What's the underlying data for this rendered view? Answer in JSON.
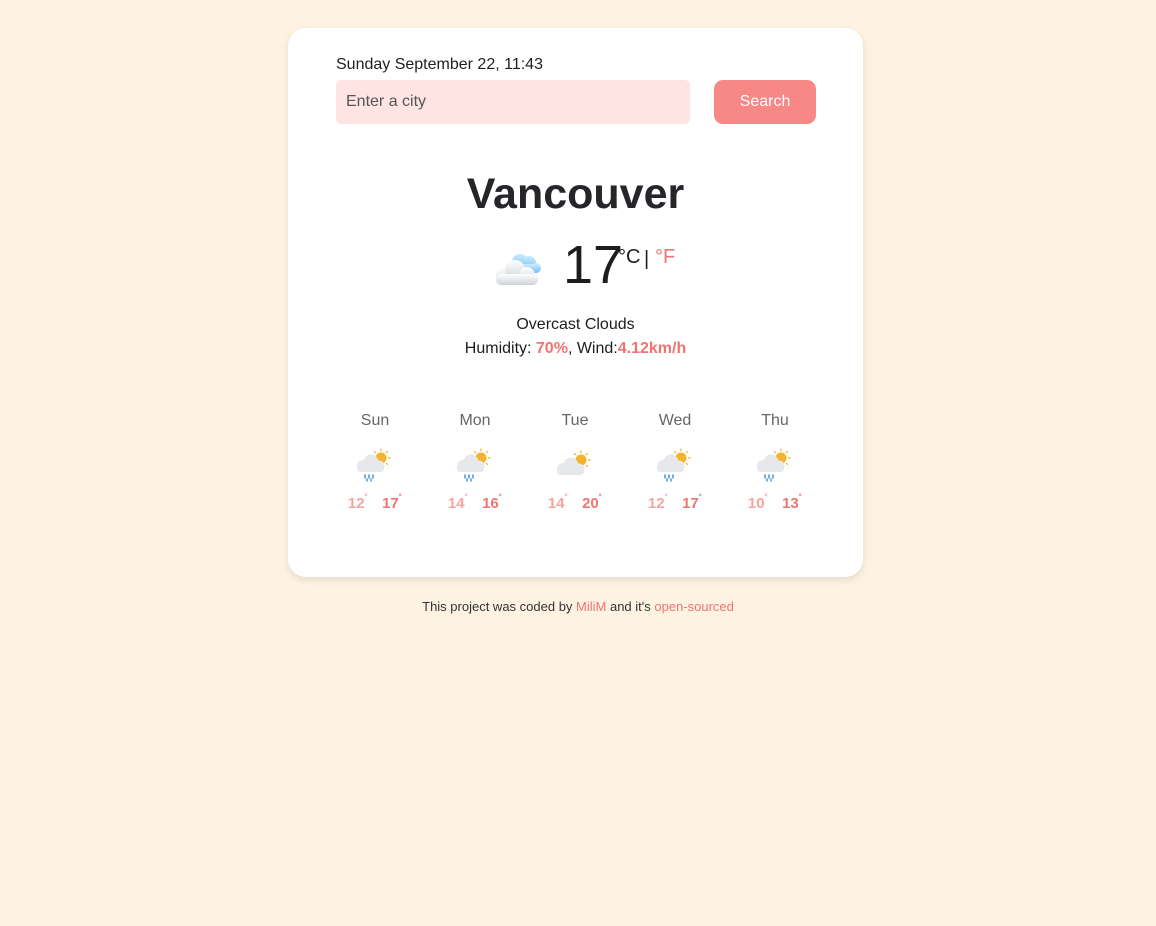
{
  "header": {
    "datetime": "Sunday September 22, 11:43"
  },
  "search": {
    "placeholder": "Enter a city",
    "value": "",
    "button_label": "Search"
  },
  "current": {
    "city": "Vancouver",
    "temperature": "17",
    "unit_celsius": "°C",
    "unit_separator": "|",
    "unit_fahrenheit": "°F",
    "icon": "overcast-clouds-icon",
    "description": "Overcast Clouds",
    "humidity_label": "Humidity: ",
    "humidity_value": "70%",
    "wind_label": ", Wind:",
    "wind_value": "4.12km/h"
  },
  "forecast": [
    {
      "day": "Sun",
      "min": "12",
      "max": "17",
      "icon": "rain-partly-sunny-icon"
    },
    {
      "day": "Mon",
      "min": "14",
      "max": "16",
      "icon": "rain-partly-sunny-icon"
    },
    {
      "day": "Tue",
      "min": "14",
      "max": "20",
      "icon": "partly-sunny-icon"
    },
    {
      "day": "Wed",
      "min": "12",
      "max": "17",
      "icon": "rain-partly-sunny-icon"
    },
    {
      "day": "Thu",
      "min": "10",
      "max": "13",
      "icon": "rain-partly-sunny-icon"
    }
  ],
  "degree_symbol": "˚",
  "footer": {
    "prefix": "This project was coded by ",
    "author": "MiliM",
    "middle": " and it's ",
    "link": "open-sourced"
  },
  "colors": {
    "background": "#fef3e2",
    "accent": "#f07471",
    "button": "#f88886",
    "input_bg": "#fee4e2"
  }
}
